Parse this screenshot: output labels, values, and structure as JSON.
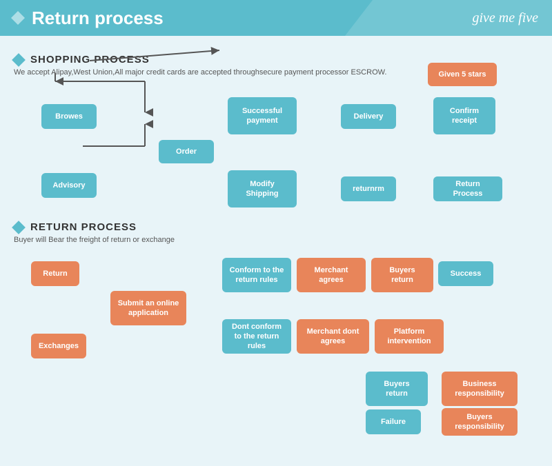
{
  "header": {
    "title": "Return process",
    "logo": "give me five"
  },
  "shopping": {
    "section_title": "SHOPPING PROCESS",
    "subtitle": "We accept Alipay,West Union,All major credit cards are accepted throughsecure payment processor ESCROW.",
    "boxes": [
      {
        "id": "browes",
        "label": "Browes",
        "type": "teal"
      },
      {
        "id": "order",
        "label": "Order",
        "type": "teal"
      },
      {
        "id": "advisory",
        "label": "Advisory",
        "type": "teal"
      },
      {
        "id": "successful_payment",
        "label": "Successful payment",
        "type": "teal"
      },
      {
        "id": "delivery",
        "label": "Delivery",
        "type": "teal"
      },
      {
        "id": "confirm_receipt",
        "label": "Confirm receipt",
        "type": "teal"
      },
      {
        "id": "given_5_stars",
        "label": "Given 5 stars",
        "type": "orange"
      },
      {
        "id": "modify_shipping",
        "label": "Modify Shipping",
        "type": "teal"
      },
      {
        "id": "returnrm",
        "label": "returnrm",
        "type": "teal"
      },
      {
        "id": "return_process",
        "label": "Return Process",
        "type": "teal"
      }
    ]
  },
  "return": {
    "section_title": "RETURN PROCESS",
    "subtitle": "Buyer will Bear the freight of return or exchange",
    "boxes": [
      {
        "id": "return_box",
        "label": "Return",
        "type": "orange"
      },
      {
        "id": "exchanges",
        "label": "Exchanges",
        "type": "orange"
      },
      {
        "id": "submit_online",
        "label": "Submit an online application",
        "type": "orange"
      },
      {
        "id": "conform_rules",
        "label": "Conform to the return rules",
        "type": "teal"
      },
      {
        "id": "dont_conform",
        "label": "Dont conform to the return rules",
        "type": "teal"
      },
      {
        "id": "merchant_agrees",
        "label": "Merchant agrees",
        "type": "orange"
      },
      {
        "id": "merchant_dont_agrees",
        "label": "Merchant dont agrees",
        "type": "orange"
      },
      {
        "id": "buyers_return1",
        "label": "Buyers return",
        "type": "orange"
      },
      {
        "id": "platform_intervention",
        "label": "Platform intervention",
        "type": "orange"
      },
      {
        "id": "success",
        "label": "Success",
        "type": "teal"
      },
      {
        "id": "buyers_return2",
        "label": "Buyers return",
        "type": "teal"
      },
      {
        "id": "business_responsibility",
        "label": "Business responsibility",
        "type": "orange"
      },
      {
        "id": "failure",
        "label": "Failure",
        "type": "teal"
      },
      {
        "id": "buyers_responsibility",
        "label": "Buyers responsibility",
        "type": "orange"
      }
    ]
  }
}
